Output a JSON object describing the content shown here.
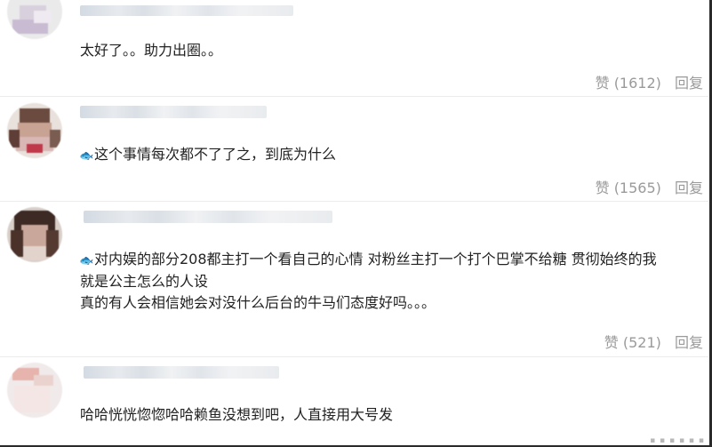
{
  "comments": [
    {
      "text_lines": [
        "太好了。。助力出圈。。"
      ],
      "has_emoji": false,
      "like_label": "赞",
      "like_count": "(1612)",
      "reply_label": "回复"
    },
    {
      "text_lines": [
        "这个事情每次都不了了之，到底为什么"
      ],
      "has_emoji": true,
      "like_label": "赞",
      "like_count": "(1565)",
      "reply_label": "回复"
    },
    {
      "text_lines": [
        "对内娱的部分208都主打一个看自己的心情 对粉丝主打一个打个巴掌不给糖 贯彻始终的我",
        "就是公主怎么的人设",
        "真的有人会相信她会对没什么后台的牛马们态度好吗。。。"
      ],
      "has_emoji": true,
      "like_label": "赞",
      "like_count": "(521)",
      "reply_label": "回复"
    },
    {
      "text_lines": [
        "哈哈恍恍惚惚哈哈赖鱼没想到吧，人直接用大号发"
      ],
      "has_emoji": false
    }
  ],
  "icons": {
    "emoji": "fish-emoji-icon"
  },
  "colors": {
    "text": "#222222",
    "muted": "#9a9a9a",
    "separator": "#ececec"
  }
}
